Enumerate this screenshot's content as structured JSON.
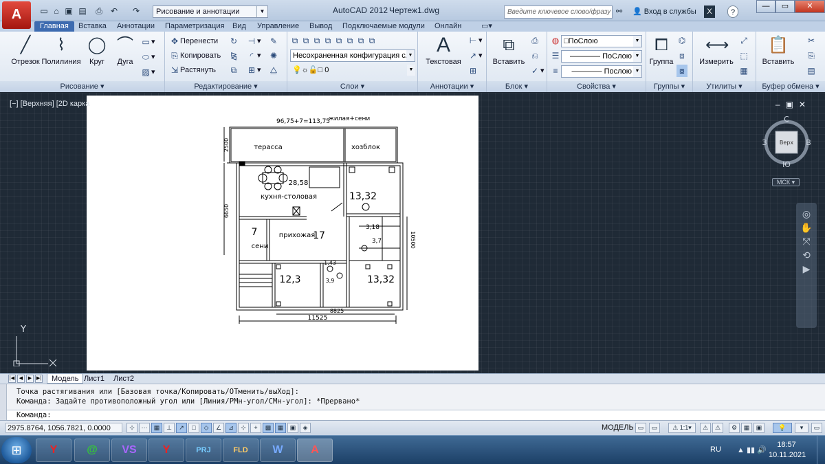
{
  "window": {
    "app_title": "AutoCAD 2012",
    "doc_title": "Чертеж1.dwg",
    "workspace": "Рисование и аннотации",
    "search_placeholder": "Введите ключевое слово/фразу",
    "signin": "Вход в службы",
    "app_button": "A"
  },
  "tabs": [
    "Главная",
    "Вставка",
    "Аннотации",
    "Параметризация",
    "Вид",
    "Управление",
    "Вывод",
    "Подключаемые модули",
    "Онлайн"
  ],
  "ribbon": {
    "draw": {
      "title": "Рисование",
      "line": "Отрезок",
      "polyline": "Полилиния",
      "circle": "Круг",
      "arc": "Дуга"
    },
    "modify": {
      "title": "Редактирование",
      "move": "Перенести",
      "copy": "Копировать",
      "stretch": "Растянуть"
    },
    "layers": {
      "title": "Слои",
      "config": "Несохраненная конфигурация сло",
      "layer": "0"
    },
    "annotation": {
      "title": "Аннотации",
      "text": "Текстовая"
    },
    "block": {
      "title": "Блок",
      "insert": "Вставить"
    },
    "properties": {
      "title": "Свойства",
      "color": "ПоСлою",
      "linetype": "ПоСлою",
      "lineweight": "Послою"
    },
    "groups": {
      "title": "Группы",
      "group": "Группа"
    },
    "utilities": {
      "title": "Утилиты",
      "measure": "Измерить"
    },
    "clipboard": {
      "title": "Буфер обмена",
      "paste": "Вставить"
    }
  },
  "viewport": {
    "label": "[−] [Верхняя] [2D карка",
    "cube": {
      "north": "С",
      "south": "Ю",
      "west": "З",
      "east": "В",
      "face": "Верх"
    },
    "ucs_menu": "МСК",
    "ucs_y": "Y"
  },
  "plan": {
    "top_dim": "96,75+7=113,75",
    "top_note": "жилая+сени",
    "terrace": "терасса",
    "shed": "хозблок",
    "kitchen_area": "28,58",
    "kitchen": "кухня-столовая",
    "room_ne": "13,32",
    "sени_num": "7",
    "seni": "сени",
    "hall": "прихожая",
    "hall_area": "17",
    "small1": "3,18",
    "small2": "3,7",
    "bath": "1,43",
    "wc": "3,9",
    "room_sw": "12,3",
    "room_se": "13,32",
    "dim_left_top": "2500",
    "dim_left": "6650",
    "dim_right": "10500",
    "dim_bottom_inner": "8825",
    "dim_bottom": "11525"
  },
  "layout_tabs": [
    "Модель",
    "Лист1",
    "Лист2"
  ],
  "command": {
    "line1": "Точка растягивания или [Базовая точка/Копировать/ОТменить/выХод]:",
    "line2": "Команда: Задайте противоположный угол или [Линия/РМн-угол/СМн-угол]: *Прервано*",
    "prompt": "Команда:"
  },
  "status": {
    "coords": "2975.8764, 1056.7821, 0.0000",
    "model": "МОДЕЛЬ",
    "scale": "1:1"
  },
  "taskbar": {
    "apps": [
      "Y",
      "@",
      "VS",
      "Y",
      "PRJ",
      "FLD",
      "W",
      "A"
    ],
    "lang": "RU",
    "time": "18:57",
    "date": "10.11.2021"
  }
}
